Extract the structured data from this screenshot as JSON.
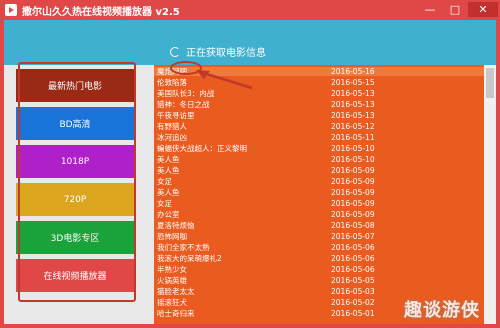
{
  "window": {
    "title": "撒尔山久久热在线视频播放器 v2.5",
    "min_glyph": "—",
    "max_glyph": "□",
    "close_glyph": "✕"
  },
  "status": {
    "text": "正在获取电影信息"
  },
  "nav": [
    {
      "label": "最新热门电影",
      "color": "#9a2a16"
    },
    {
      "label": "BD高清",
      "color": "#1a73d9"
    },
    {
      "label": "1018P",
      "color": "#b020c8"
    },
    {
      "label": "720P",
      "color": "#dca51e"
    },
    {
      "label": "3D电影专区",
      "color": "#1aa33a"
    },
    {
      "label": "在线视频播放器",
      "color": "#e04848"
    }
  ],
  "movies": [
    {
      "title": "魔炮网吧",
      "date": "2016-05-16"
    },
    {
      "title": "伦敦陷落",
      "date": "2016-05-15"
    },
    {
      "title": "美国队长3：内战",
      "date": "2016-05-13"
    },
    {
      "title": "猎神：冬日之战",
      "date": "2016-05-13"
    },
    {
      "title": "午夜寻访里",
      "date": "2016-05-13"
    },
    {
      "title": "有野猎人",
      "date": "2016-05-12"
    },
    {
      "title": "冰河追凶",
      "date": "2016-05-11"
    },
    {
      "title": "蝙蝠侠大战超人：正义黎明",
      "date": "2016-05-10"
    },
    {
      "title": "美人鱼",
      "date": "2016-05-10"
    },
    {
      "title": "美人鱼",
      "date": "2016-05-09"
    },
    {
      "title": "女足",
      "date": "2016-05-09"
    },
    {
      "title": "美人鱼",
      "date": "2016-05-09"
    },
    {
      "title": "女足",
      "date": "2016-05-09"
    },
    {
      "title": "办公室",
      "date": "2016-05-09"
    },
    {
      "title": "夏洛特烦恼",
      "date": "2016-05-08"
    },
    {
      "title": "恐怖网咖",
      "date": "2016-05-07"
    },
    {
      "title": "我们全家不太熟",
      "date": "2016-05-06"
    },
    {
      "title": "我滚大的呆萌爆礼2",
      "date": "2016-05-06"
    },
    {
      "title": "半熟少女",
      "date": "2016-05-06"
    },
    {
      "title": "火锅英雄",
      "date": "2016-05-05"
    },
    {
      "title": "猫脸老太太",
      "date": "2016-05-03"
    },
    {
      "title": "摇滚狂犬",
      "date": "2016-05-02"
    },
    {
      "title": "哈士奇归来",
      "date": "2016-05-01"
    }
  ],
  "watermark": {
    "text": "趣谈游侠"
  },
  "colors": {
    "header": "#3fb0cf",
    "list_bg": "#ea5b1f",
    "window": "#e04848"
  }
}
